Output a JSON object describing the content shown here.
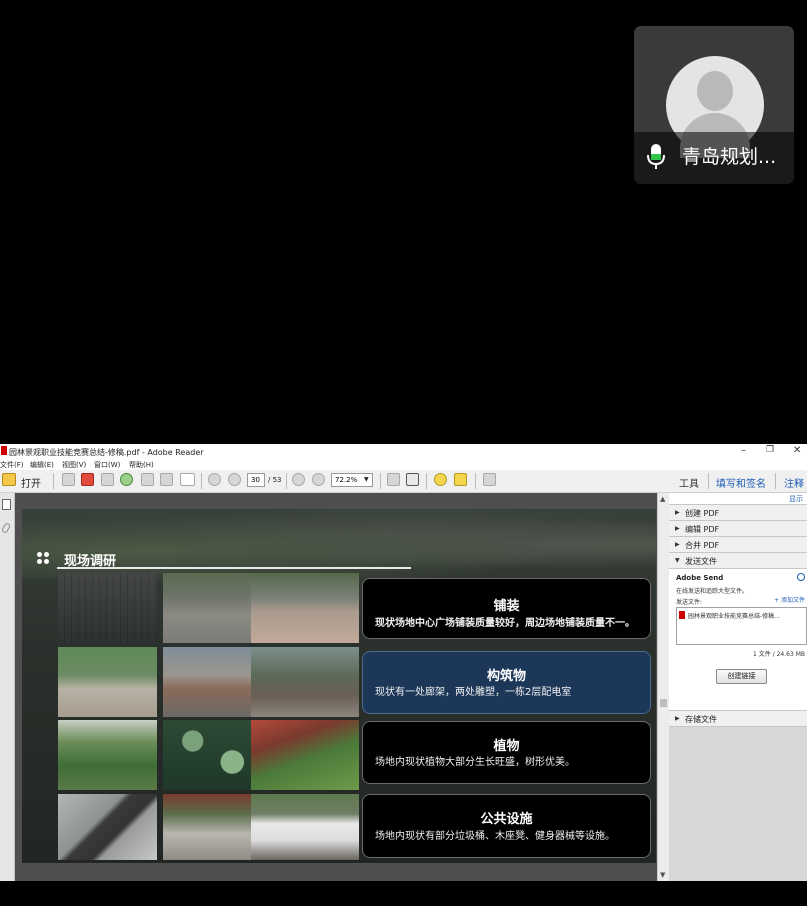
{
  "video_tile": {
    "participant_name": "青岛规划..."
  },
  "reader": {
    "window_title": "园林景观职业技能竞赛总结-修稿.pdf - Adobe Reader",
    "window_controls": [
      "–",
      "❐",
      "✕"
    ],
    "menu": [
      "文件(F)",
      "编辑(E)",
      "视图(V)",
      "窗口(W)",
      "帮助(H)"
    ],
    "toolbar": {
      "open_label": "打开",
      "page_current": "30",
      "page_total": "/ 53",
      "zoom": "72.2%",
      "tools_link": "工具",
      "sign_link": "填写和签名",
      "comment_link": "注释"
    }
  },
  "slide": {
    "section_title": "现场调研",
    "cards": [
      {
        "title": "铺装",
        "desc": "现状场地中心广场铺装质量较好，周边场地铺装质量不一。"
      },
      {
        "title": "构筑物",
        "desc": "现状有一处廊架，两处雕塑，一栋2层配电室"
      },
      {
        "title": "植物",
        "desc": "场地内现状植物大部分生长旺盛，树形优美。"
      },
      {
        "title": "公共设施",
        "desc": "场地内现状有部分垃圾桶、木座凳、健身器械等设施。"
      }
    ]
  },
  "right_pane": {
    "top_link": "显示",
    "sections": [
      "创建 PDF",
      "编辑 PDF",
      "合并 PDF",
      "发送文件"
    ],
    "send": {
      "title": "Adobe Send",
      "subtitle": "在线发送和追踪大型文件。",
      "file_label": "发送文件:",
      "add_link": "+ 添加文件",
      "file_name": "园林景观职业技能竞赛总结-修稿...",
      "count": "1 文件 / 24.63 MB",
      "create_button": "创建链接"
    },
    "storage_section": "存储文件"
  },
  "colors": {
    "card_highlight": "#1c3758",
    "link_blue": "#1e5db6",
    "mic_green": "#2fc24a"
  }
}
